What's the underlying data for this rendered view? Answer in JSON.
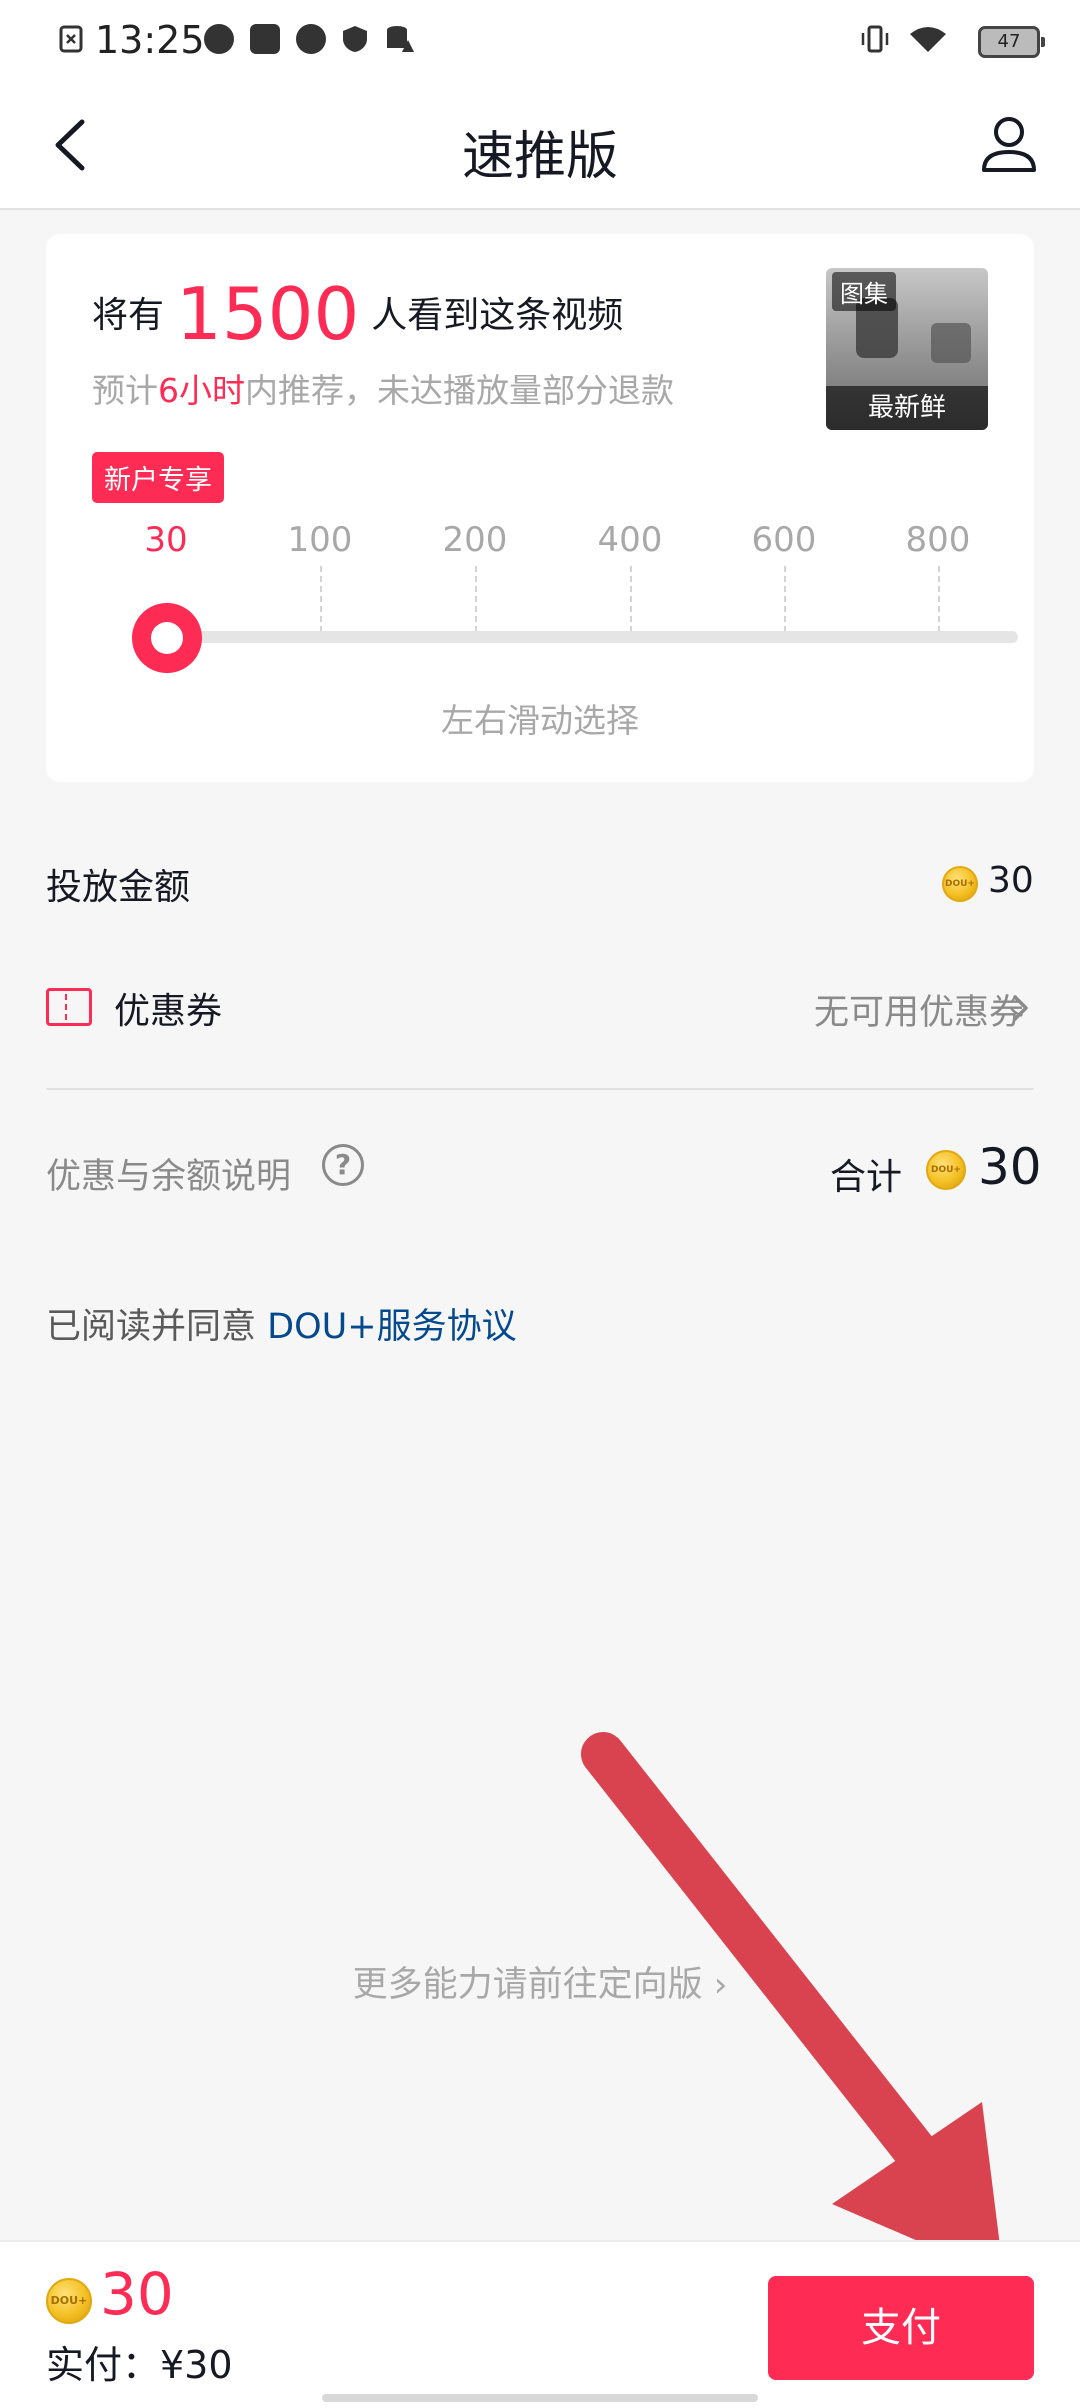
{
  "status_bar": {
    "time": "13:25",
    "battery": "47"
  },
  "header": {
    "title": "速推版"
  },
  "reach": {
    "prefix": "将有",
    "count": "1500",
    "suffix": "人看到这条视频"
  },
  "estimate": {
    "prefix": "预计",
    "highlight": "6小时",
    "suffix": "内推荐，未达播放量部分退款"
  },
  "thumbnail": {
    "tag": "图集",
    "caption": "最新鲜"
  },
  "new_user_badge": "新户专享",
  "slider": {
    "ticks": [
      "30",
      "100",
      "200",
      "400",
      "600",
      "800"
    ],
    "selected": "30",
    "hint": "左右滑动选择"
  },
  "budget": {
    "label": "投放金额",
    "value": "30"
  },
  "coupon": {
    "label": "优惠券",
    "status": "无可用优惠券"
  },
  "discount_note": {
    "label": "优惠与余额说明",
    "help": "?"
  },
  "total": {
    "label": "合计",
    "value": "30"
  },
  "agreement": {
    "prefix": "已阅读并同意",
    "link": "DOU+服务协议"
  },
  "more_link": "更多能力请前往定向版",
  "bottom_bar": {
    "coin_value": "30",
    "paid_label": "实付：¥30",
    "pay_button": "支付"
  },
  "coin_icon_text": "DOU+",
  "colors": {
    "accent": "#fe2c55",
    "link": "#04498d",
    "annotation_arrow": "#d9434f"
  }
}
